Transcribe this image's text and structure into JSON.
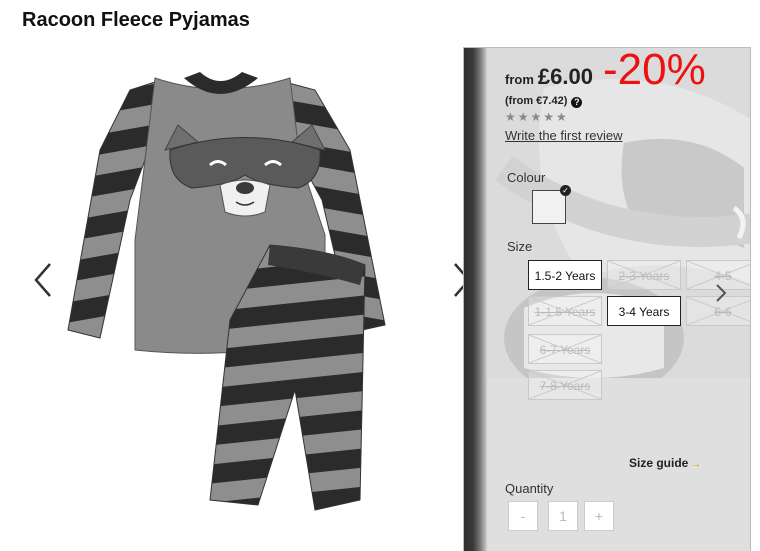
{
  "product": {
    "title": "Racoon Fleece Pyjamas"
  },
  "gallery": {
    "prev_icon": "chevron-left-icon",
    "next_icon": "chevron-right-icon"
  },
  "price": {
    "from_label": "from",
    "amount": "£6.00",
    "discount": "-20%",
    "secondary": "(from €7.42)",
    "help_icon": "?"
  },
  "reviews": {
    "stars": "★★★★★",
    "rating_value": 0,
    "link": "Write the first review"
  },
  "colour": {
    "label": "Colour",
    "selected_mark": "✓"
  },
  "size": {
    "label": "Size",
    "options": [
      {
        "label": "1.5-2 Years",
        "available": true
      },
      {
        "label": "2-3 Years",
        "available": false
      },
      {
        "label": "4-5",
        "available": false
      },
      {
        "label": "1-1.5 Years",
        "available": false
      },
      {
        "label": "3-4 Years",
        "available": true
      },
      {
        "label": "5-6",
        "available": false
      },
      {
        "label": "6-7 Years",
        "available": false
      },
      {
        "label": "7-8 Years",
        "available": false
      }
    ],
    "guide_label": "Size guide",
    "guide_arrow": "→"
  },
  "quantity": {
    "label": "Quantity",
    "minus": "-",
    "value": "1",
    "plus": "+"
  },
  "colors": {
    "discount": "#ee1111",
    "guide_arrow": "#e8a020"
  }
}
